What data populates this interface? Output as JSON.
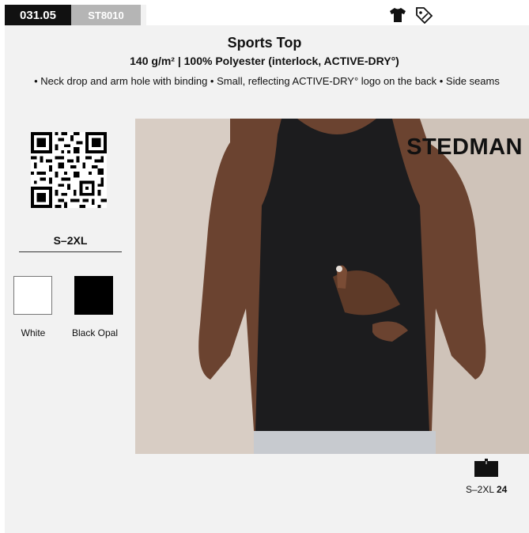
{
  "header": {
    "code": "031.05",
    "sku": "ST8010",
    "icons": [
      "tshirt-icon",
      "percent-tag-icon"
    ]
  },
  "product": {
    "title": "Sports Top",
    "subtitle": "140 g/m² | 100% Polyester (interlock, ACTIVE-DRY°)",
    "features": "• Neck drop and arm hole with binding • Small, reflecting ACTIVE-DRY° logo on the back • Side seams"
  },
  "sizes": "S–2XL",
  "colors": [
    {
      "name": "White",
      "hex": "#ffffff"
    },
    {
      "name": "Black Opal",
      "hex": "#000000"
    }
  ],
  "brand": "STEDMAN",
  "packaging": {
    "size_range": "S–2XL",
    "quantity": "24"
  }
}
